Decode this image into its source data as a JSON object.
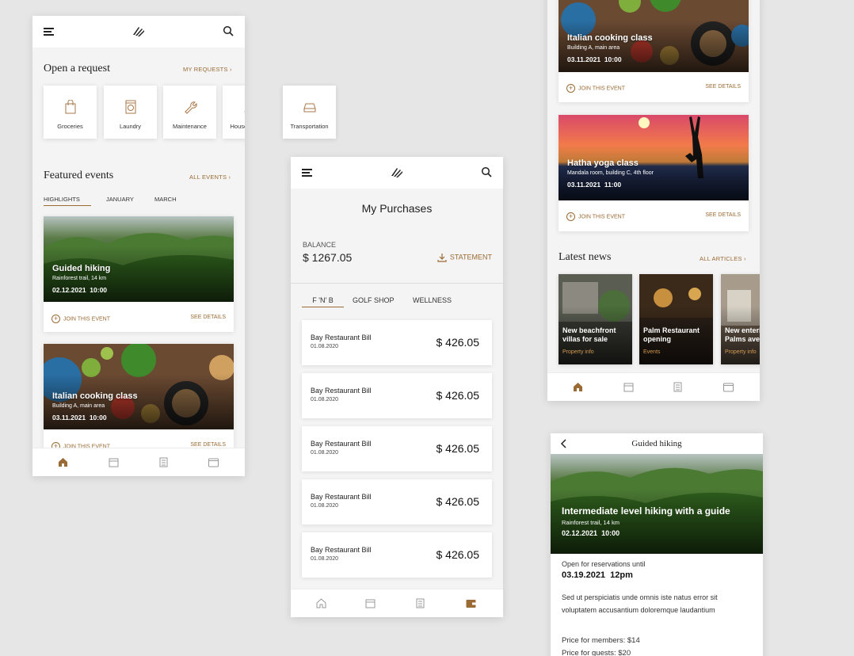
{
  "screen1": {
    "request_title": "Open a request",
    "my_requests": "MY REQUESTS",
    "tiles": [
      "Groceries",
      "Laundry",
      "Maintenance",
      "Housekeeping",
      "Transportation"
    ],
    "featured_title": "Featured events",
    "all_events": "ALL EVENTS",
    "tabs": [
      "HIGHLIGHTS",
      "JANUARY",
      "MARCH"
    ],
    "events": [
      {
        "title": "Guided hiking",
        "place": "Rainforest trail, 14 km",
        "date": "02.12.2021",
        "time": "10:00",
        "join": "JOIN THIS EVENT",
        "details": "SEE DETAILS"
      },
      {
        "title": "Italian cooking class",
        "place": "Building A, main area",
        "date": "03.11.2021",
        "time": "10:00",
        "join": "JOIN THIS EVENT",
        "details": "SEE DETAILS"
      }
    ]
  },
  "screen2": {
    "title": "My Purchases",
    "balance_label": "BALANCE",
    "balance": "$ 1267.05",
    "statement": "STATEMENT",
    "tabs": [
      "F 'N' B",
      "GOLF SHOP",
      "WELLNESS"
    ],
    "purchases": [
      {
        "name": "Bay Restaurant Bill",
        "date": "01.08.2020",
        "amount": "$ 426.05"
      },
      {
        "name": "Bay Restaurant Bill",
        "date": "01.08.2020",
        "amount": "$ 426.05"
      },
      {
        "name": "Bay Restaurant Bill",
        "date": "01.08.2020",
        "amount": "$ 426.05"
      },
      {
        "name": "Bay Restaurant Bill",
        "date": "01.08.2020",
        "amount": "$ 426.05"
      },
      {
        "name": "Bay Restaurant Bill",
        "date": "01.08.2020",
        "amount": "$ 426.05"
      }
    ]
  },
  "screen3": {
    "events": [
      {
        "title": "Italian cooking class",
        "place": "Building A, main area",
        "date": "03.11.2021",
        "time": "10:00",
        "join": "JOIN THIS EVENT",
        "details": "SEE DETAILS"
      },
      {
        "title": "Hatha yoga class",
        "place": "Mandala room, building C, 4th floor",
        "date": "03.11.2021",
        "time": "11:00",
        "join": "JOIN THIS EVENT",
        "details": "SEE DETAILS"
      }
    ],
    "news_title": "Latest news",
    "all_articles": "ALL ARTICLES",
    "news": [
      {
        "title": "New beachfront villas for sale",
        "category": "Property info"
      },
      {
        "title": "Palm Restaurant opening",
        "category": "Events"
      },
      {
        "title": "New enterior for Palms ave. villas",
        "category": "Property info"
      }
    ]
  },
  "screen4": {
    "header": "Guided hiking",
    "hero_title": "Intermediate level hiking with a guide",
    "place": "Rainforest trail, 14 km",
    "date": "02.12.2021",
    "time": "10:00",
    "open_label": "Open for reservations until",
    "open_value": "03.19.2021  12pm",
    "description": "Sed ut perspiciatis unde omnis iste natus error sit voluptatem accusantium doloremque laudantium",
    "price_members": "Price for members: $14",
    "price_guests": "Price for guests: $20"
  },
  "colors": {
    "accent": "#9a6b34",
    "news_category": "#d29a52",
    "background": "#e6e6e6"
  }
}
